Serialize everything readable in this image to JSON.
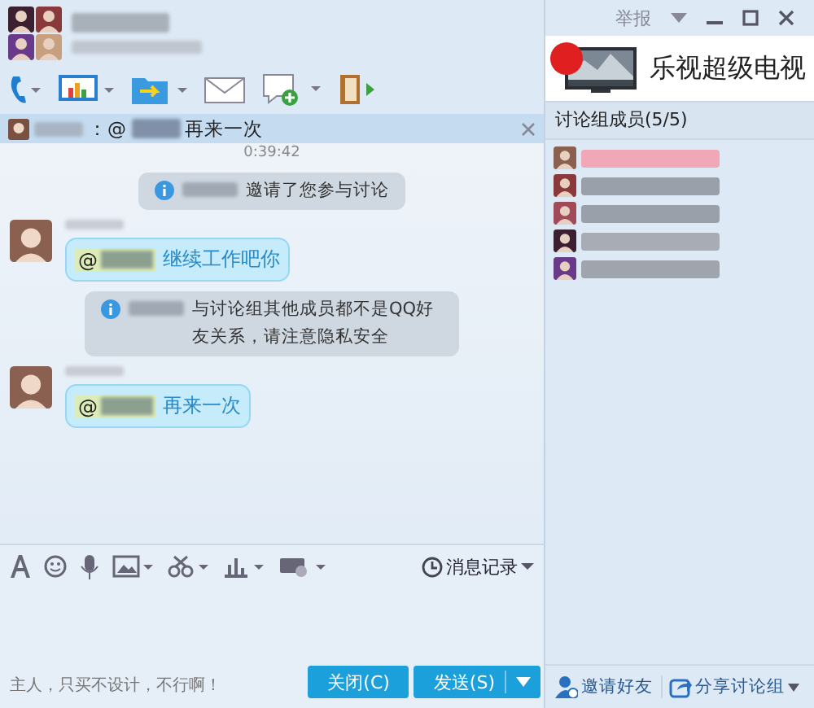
{
  "title_bar": {
    "report": "举报"
  },
  "ad": {
    "text": "乐视超级电视"
  },
  "notice": {
    "separator": "：@",
    "text": "再来一次"
  },
  "chat": {
    "time": "0:39:42",
    "messages": [
      {
        "kind": "system",
        "text": "邀请了您参与讨论"
      },
      {
        "kind": "bubble",
        "at": "@",
        "text": "继续工作吧你"
      },
      {
        "kind": "system",
        "text": "与讨论组其他成员都不是QQ好友关系，请注意隐私安全"
      },
      {
        "kind": "bubble",
        "at": "@",
        "text": "再来一次"
      }
    ]
  },
  "input_toolbar": {
    "history": "消息记录"
  },
  "input": {
    "placeholder": "主人，只买不设计，不行啊！"
  },
  "buttons": [
    {
      "kind": "close",
      "label": "关闭(C)"
    },
    {
      "kind": "send",
      "label": "发送(S)"
    }
  ],
  "members": {
    "title": "讨论组成员(5/5)",
    "items": [
      {
        "color": "#f0a8b8"
      },
      {
        "color": "#9aa0aa"
      },
      {
        "color": "#9aa0aa"
      },
      {
        "color": "#a8acb4"
      },
      {
        "color": "#a0a4ac"
      }
    ]
  },
  "member_actions": [
    {
      "kind": "invite",
      "label": "邀请好友"
    },
    {
      "kind": "share",
      "label": "分享讨论组"
    }
  ]
}
